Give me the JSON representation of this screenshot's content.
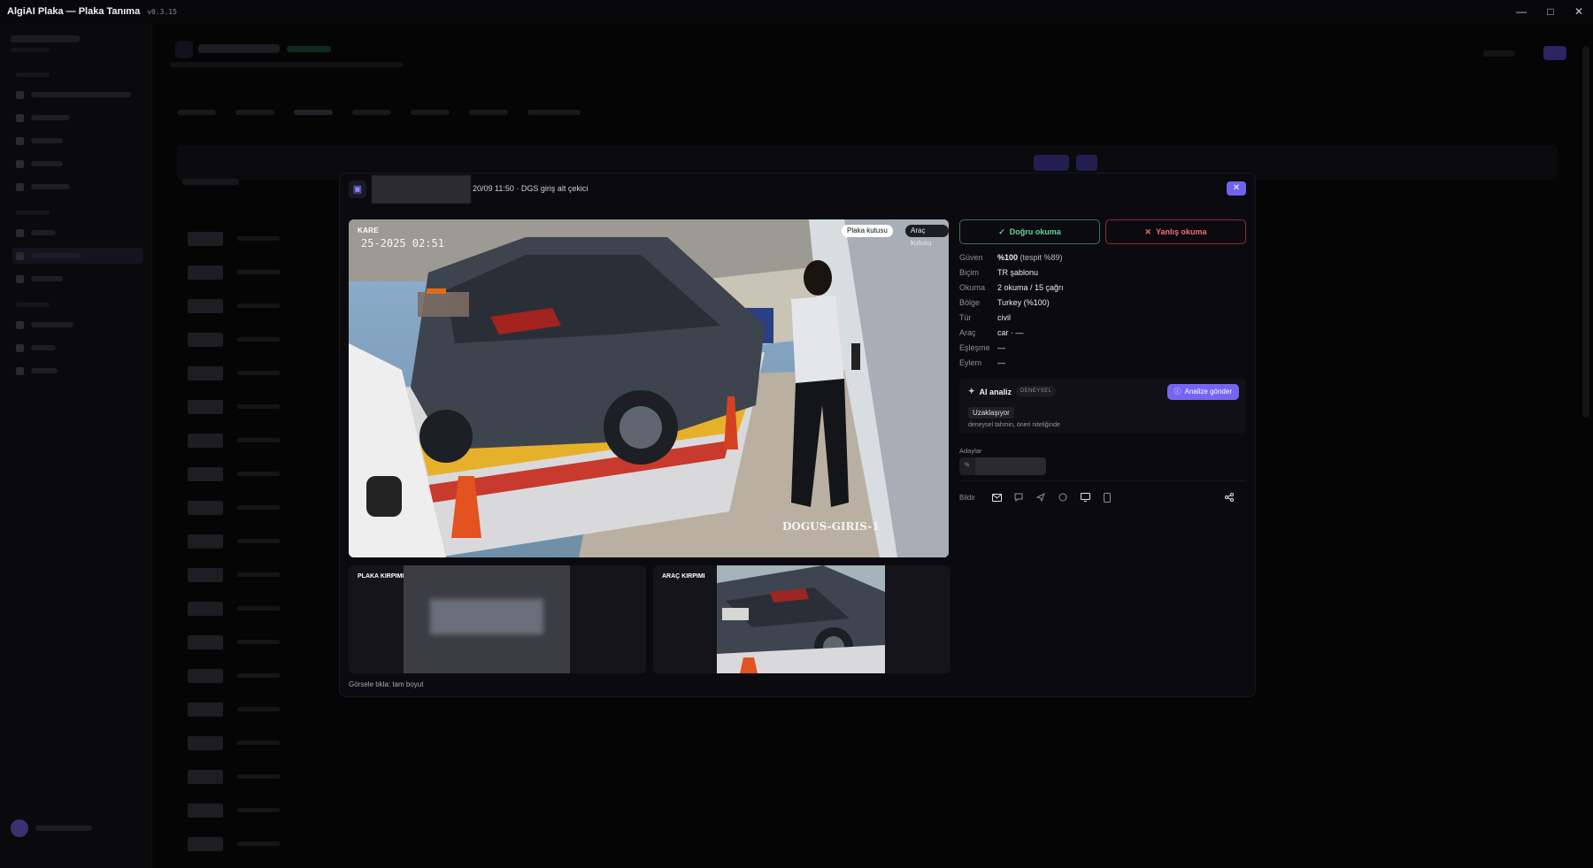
{
  "app": {
    "title": "AlgiAI Plaka — Plaka Tanıma",
    "version": "v0.3.15"
  },
  "modal": {
    "header_text": "20/09 11:50 · DGS giriş alt çekici",
    "frame": {
      "label": "KARE",
      "timestamp": "25-2025 02:51",
      "camera_overlay": "DOGUS-GIRIS-1",
      "toggle_plate": "Plaka kutusu",
      "toggle_vehicle": "Araç kutusu"
    },
    "crops": {
      "plate_label": "PLAKA KIRPIMI",
      "vehicle_label": "ARAÇ KIRPIMI",
      "hint": "Görsele tıkla: tam boyut"
    },
    "actions": {
      "correct": "Doğru okuma",
      "wrong": "Yanlış okuma"
    },
    "details": [
      {
        "key": "Güven",
        "value_bold": "%100",
        "value_muted": " (tespit %89)"
      },
      {
        "key": "Biçim",
        "value": "TR şablonu"
      },
      {
        "key": "Okuma",
        "value": "2 okuma / 15 çağrı"
      },
      {
        "key": "Bölge",
        "value": "Turkey (%100)"
      },
      {
        "key": "Tür",
        "value": "civil"
      },
      {
        "key": "Araç",
        "value": "car · —"
      },
      {
        "key": "Eşleşme",
        "value": "—"
      },
      {
        "key": "Eylem",
        "value": "—"
      }
    ],
    "ai": {
      "title": "AI analiz",
      "tag": "DENEYSEL",
      "send_label": "Analize gönder",
      "chip": "Uzaklaşıyor",
      "note": "deneysel tahmin, öneri niteliğinde"
    },
    "candidates": {
      "label": "Adaylar",
      "pct": "%"
    },
    "notify": {
      "label": "Bildir",
      "icons": [
        "mail-icon",
        "chat-icon",
        "send-icon",
        "whatsapp-icon",
        "monitor-icon",
        "phone-icon"
      ],
      "share_icon": "share-icon"
    }
  },
  "colors": {
    "accent": "#6e62f2",
    "ok": "#5fd39e",
    "bad": "#f26d74"
  }
}
